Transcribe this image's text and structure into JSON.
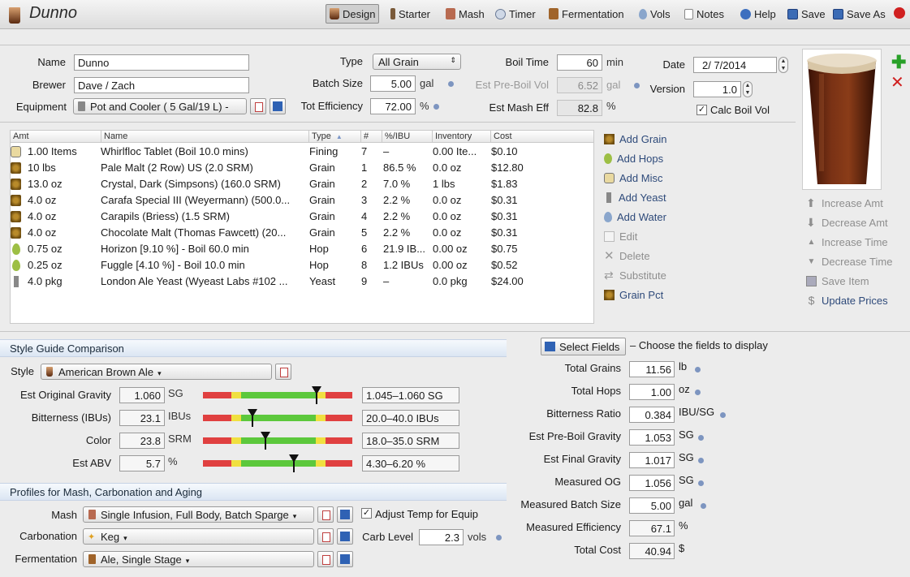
{
  "app": {
    "title": "Dunno"
  },
  "toolbar": [
    {
      "label": "Design",
      "icon": "beer-glass-icon",
      "active": true
    },
    {
      "label": "Starter",
      "icon": "flask-icon"
    },
    {
      "label": "Mash",
      "icon": "mash-tun-icon"
    },
    {
      "label": "Timer",
      "icon": "clock-icon"
    },
    {
      "label": "Fermentation",
      "icon": "fermenter-icon"
    },
    {
      "label": "Vols",
      "icon": "water-drop-icon"
    },
    {
      "label": "Notes",
      "icon": "notes-icon"
    },
    {
      "label": "Help",
      "icon": "help-icon"
    },
    {
      "label": "Save",
      "icon": "save-icon"
    },
    {
      "label": "Save As",
      "icon": "save-as-icon"
    }
  ],
  "recipe": {
    "name_label": "Name",
    "name": "Dunno",
    "brewer_label": "Brewer",
    "brewer": "Dave / Zach",
    "equipment_label": "Equipment",
    "equipment": "Pot and Cooler ( 5 Gal/19 L) -",
    "type_label": "Type",
    "type": "All Grain",
    "batch_size_label": "Batch Size",
    "batch_size": "5.00",
    "batch_unit": "gal",
    "tot_eff_label": "Tot Efficiency",
    "tot_eff": "72.00",
    "tot_eff_unit": "%",
    "boil_time_label": "Boil Time",
    "boil_time": "60",
    "boil_unit": "min",
    "pre_boil_label": "Est Pre-Boil Vol",
    "pre_boil": "6.52",
    "pre_boil_unit": "gal",
    "mash_eff_label": "Est Mash Eff",
    "mash_eff": "82.8",
    "mash_eff_unit": "%",
    "date_label": "Date",
    "date": "2/ 7/2014",
    "version_label": "Version",
    "version": "1.0",
    "calc_boil_label": "Calc Boil Vol",
    "calc_boil_check": "✓"
  },
  "table": {
    "headers": [
      "Amt",
      "Name",
      "Type",
      "#",
      "%/IBU",
      "Inventory",
      "Cost"
    ],
    "rows": [
      {
        "kind": "misc",
        "amt": "1.00 Items",
        "name": "Whirlfloc Tablet (Boil 10.0 mins)",
        "type": "Fining",
        "num": "7",
        "pct": "–",
        "inv": "0.00 Ite...",
        "cost": "$0.10"
      },
      {
        "kind": "grain",
        "amt": "10 lbs",
        "name": "Pale Malt (2 Row) US (2.0 SRM)",
        "type": "Grain",
        "num": "1",
        "pct": "86.5 %",
        "inv": "0.0 oz",
        "cost": "$12.80"
      },
      {
        "kind": "grain",
        "amt": "13.0 oz",
        "name": "Crystal, Dark (Simpsons) (160.0 SRM)",
        "type": "Grain",
        "num": "2",
        "pct": "7.0 %",
        "inv": "1 lbs",
        "cost": "$1.83"
      },
      {
        "kind": "grain",
        "amt": "4.0 oz",
        "name": "Carafa Special III (Weyermann) (500.0...",
        "type": "Grain",
        "num": "3",
        "pct": "2.2 %",
        "inv": "0.0 oz",
        "cost": "$0.31"
      },
      {
        "kind": "grain",
        "amt": "4.0 oz",
        "name": "Carapils (Briess) (1.5 SRM)",
        "type": "Grain",
        "num": "4",
        "pct": "2.2 %",
        "inv": "0.0 oz",
        "cost": "$0.31"
      },
      {
        "kind": "grain",
        "amt": "4.0 oz",
        "name": "Chocolate Malt (Thomas Fawcett) (20...",
        "type": "Grain",
        "num": "5",
        "pct": "2.2 %",
        "inv": "0.0 oz",
        "cost": "$0.31"
      },
      {
        "kind": "hop",
        "amt": "0.75 oz",
        "name": "Horizon [9.10 %] - Boil 60.0 min",
        "type": "Hop",
        "num": "6",
        "pct": "21.9 IB...",
        "inv": "0.00 oz",
        "cost": "$0.75"
      },
      {
        "kind": "hop",
        "amt": "0.25 oz",
        "name": "Fuggle [4.10 %] - Boil 10.0 min",
        "type": "Hop",
        "num": "8",
        "pct": "1.2 IBUs",
        "inv": "0.00 oz",
        "cost": "$0.52"
      },
      {
        "kind": "yeast",
        "amt": "4.0 pkg",
        "name": "London Ale Yeast (Wyeast Labs #102 ...",
        "type": "Yeast",
        "num": "9",
        "pct": "–",
        "inv": "0.0 pkg",
        "cost": "$24.00"
      }
    ]
  },
  "actions": [
    {
      "label": "Add Grain",
      "icon": "grain-icon",
      "enabled": true
    },
    {
      "label": "Add Hops",
      "icon": "hops-icon",
      "enabled": true
    },
    {
      "label": "Add Misc",
      "icon": "misc-icon",
      "enabled": true
    },
    {
      "label": "Add Yeast",
      "icon": "yeast-icon",
      "enabled": true
    },
    {
      "label": "Add Water",
      "icon": "water-drop-icon",
      "enabled": true
    },
    {
      "label": "Edit",
      "icon": "edit-icon",
      "enabled": false
    },
    {
      "label": "Delete",
      "icon": "delete-icon",
      "enabled": false
    },
    {
      "label": "Substitute",
      "icon": "substitute-icon",
      "enabled": false
    },
    {
      "label": "Grain Pct",
      "icon": "grain-icon",
      "enabled": true
    }
  ],
  "actions2": [
    {
      "label": "Increase Amt",
      "icon": "arrow-up-icon"
    },
    {
      "label": "Decrease Amt",
      "icon": "arrow-down-icon"
    },
    {
      "label": "Increase Time",
      "icon": "triangle-up-icon"
    },
    {
      "label": "Decrease Time",
      "icon": "triangle-down-icon"
    },
    {
      "label": "Save Item",
      "icon": "save-icon"
    },
    {
      "label": "Update Prices",
      "icon": "dollar-icon",
      "enabled": true
    }
  ],
  "style": {
    "section_title": "Style Guide Comparison",
    "style_label": "Style",
    "style_value": "American Brown Ale",
    "rows": [
      {
        "label": "Est Original Gravity",
        "value": "1.060",
        "unit": "SG",
        "range": "1.045–1.060 SG",
        "position": 0.76
      },
      {
        "label": "Bitterness (IBUs)",
        "value": "23.1",
        "unit": "IBUs",
        "range": "20.0–40.0 IBUs",
        "position": 0.33
      },
      {
        "label": "Color",
        "value": "23.8",
        "unit": "SRM",
        "range": "18.0–35.0 SRM",
        "position": 0.42
      },
      {
        "label": "Est ABV",
        "value": "5.7",
        "unit": "%",
        "range": "4.30–6.20 %",
        "position": 0.61
      }
    ]
  },
  "profiles": {
    "section_title": "Profiles for Mash, Carbonation and Aging",
    "mash_label": "Mash",
    "mash": "Single Infusion, Full Body, Batch Sparge",
    "carb_label": "Carbonation",
    "carb": "Keg",
    "ferm_label": "Fermentation",
    "ferm": "Ale, Single Stage",
    "adjust_label": "Adjust Temp for Equip",
    "adjust_check": "✓",
    "carb_level_label": "Carb Level",
    "carb_level": "2.3",
    "carb_unit": "vols"
  },
  "stats": {
    "select_fields": "Select Fields",
    "select_hint": "– Choose the fields to display",
    "rows": [
      {
        "label": "Total Grains",
        "value": "11.56",
        "unit": "lb"
      },
      {
        "label": "Total Hops",
        "value": "1.00",
        "unit": "oz"
      },
      {
        "label": "Bitterness Ratio",
        "value": "0.384",
        "unit": "IBU/SG"
      },
      {
        "label": "Est Pre-Boil Gravity",
        "value": "1.053",
        "unit": "SG"
      },
      {
        "label": "Est Final Gravity",
        "value": "1.017",
        "unit": "SG"
      },
      {
        "label": "Measured OG",
        "value": "1.056",
        "unit": "SG"
      },
      {
        "label": "Measured Batch Size",
        "value": "5.00",
        "unit": "gal"
      },
      {
        "label": "Measured Efficiency",
        "value": "67.1",
        "unit": "%"
      },
      {
        "label": "Total Cost",
        "value": "40.94",
        "unit": "$"
      }
    ]
  },
  "colors": {
    "beer": "#5a2410",
    "accent": "#2e4a7a",
    "add": "#28a028",
    "remove": "#d02020"
  }
}
